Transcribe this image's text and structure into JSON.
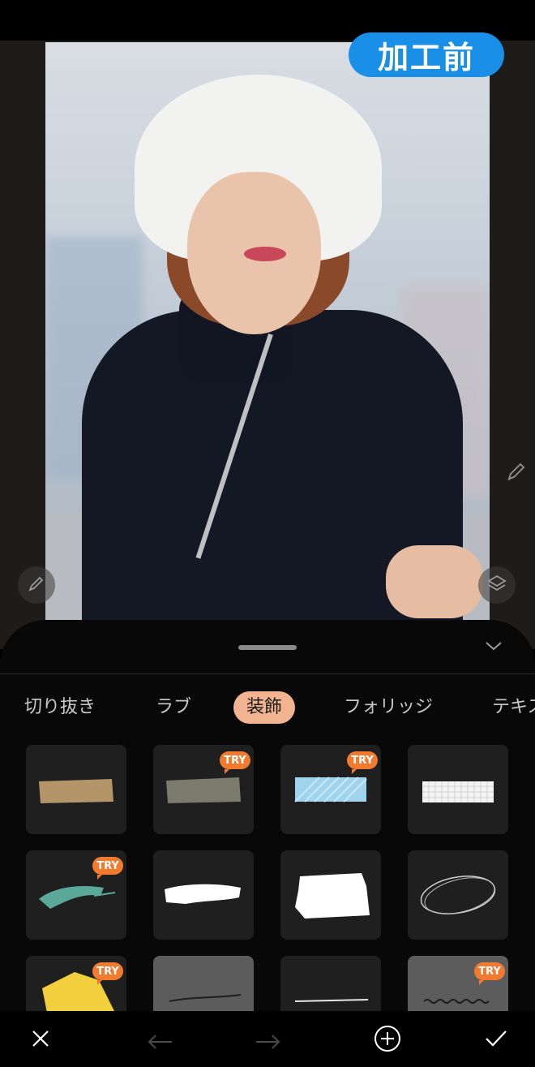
{
  "badge": {
    "label": "加工前",
    "color": "#1a8fe8"
  },
  "tabs": [
    {
      "label": "切り抜き",
      "active": false
    },
    {
      "label": "ラブ",
      "active": false
    },
    {
      "label": "装飾",
      "active": true
    },
    {
      "label": "フォリッジ",
      "active": false
    },
    {
      "label": "テキス",
      "active": false
    }
  ],
  "stickers": [
    {
      "name": "tape-beige",
      "try": false
    },
    {
      "name": "tape-gray",
      "try": true,
      "try_label": "TRY"
    },
    {
      "name": "tape-blue-pattern",
      "try": true,
      "try_label": "TRY"
    },
    {
      "name": "tape-grid",
      "try": false
    },
    {
      "name": "brush-teal",
      "try": true,
      "try_label": "TRY"
    },
    {
      "name": "brush-white-stroke",
      "try": false
    },
    {
      "name": "brush-white-block",
      "try": false
    },
    {
      "name": "ellipse-scribble",
      "try": false
    },
    {
      "name": "brush-yellow",
      "try": true,
      "try_label": "TRY"
    },
    {
      "name": "line-dark",
      "try": false
    },
    {
      "name": "line-white",
      "try": false
    },
    {
      "name": "wave-line",
      "try": true,
      "try_label": "TRY"
    }
  ],
  "toolbar": {
    "icons": [
      "close-icon",
      "undo-icon",
      "redo-icon",
      "add-icon",
      "confirm-icon"
    ]
  },
  "colors": {
    "accent_tab": "#f2b391",
    "try_badge": "#f27a2f"
  }
}
